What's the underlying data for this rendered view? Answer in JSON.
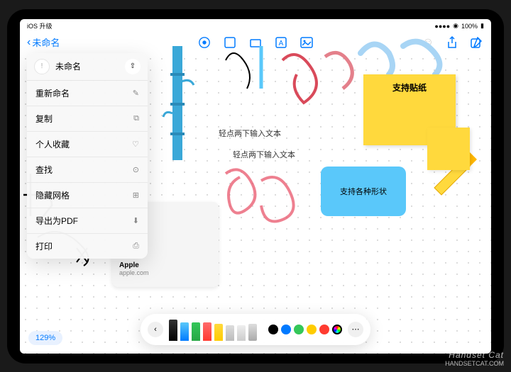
{
  "status": {
    "left": "iOS 升级",
    "battery": "100%"
  },
  "nav": {
    "back_label": "未命名"
  },
  "menu": {
    "title": "未命名",
    "items": [
      {
        "label": "重新命名",
        "icon": "✎"
      },
      {
        "label": "复制",
        "icon": "⧉"
      },
      {
        "label": "个人收藏",
        "icon": "♡"
      },
      {
        "label": "查找",
        "icon": "⊙"
      },
      {
        "label": "隐藏网格",
        "icon": "⊞"
      },
      {
        "label": "导出为PDF",
        "icon": "⬇"
      },
      {
        "label": "打印",
        "icon": "⎙"
      }
    ]
  },
  "canvas": {
    "sticky_note": "支持贴纸",
    "shape_box": "支持各种形状",
    "text_hint1": "轻点两下输入文本",
    "text_hint2": "轻点两下输入文本",
    "apple_card": {
      "title": "Apple",
      "subtitle": "apple.com"
    }
  },
  "zoom": "129%",
  "watermark": {
    "main": "Handset Cat",
    "sub": "HANDSETCAT.COM"
  },
  "colors": {
    "palette": [
      "#000000",
      "#007aff",
      "#34c759",
      "#ffcc00",
      "#ff3b30"
    ]
  }
}
